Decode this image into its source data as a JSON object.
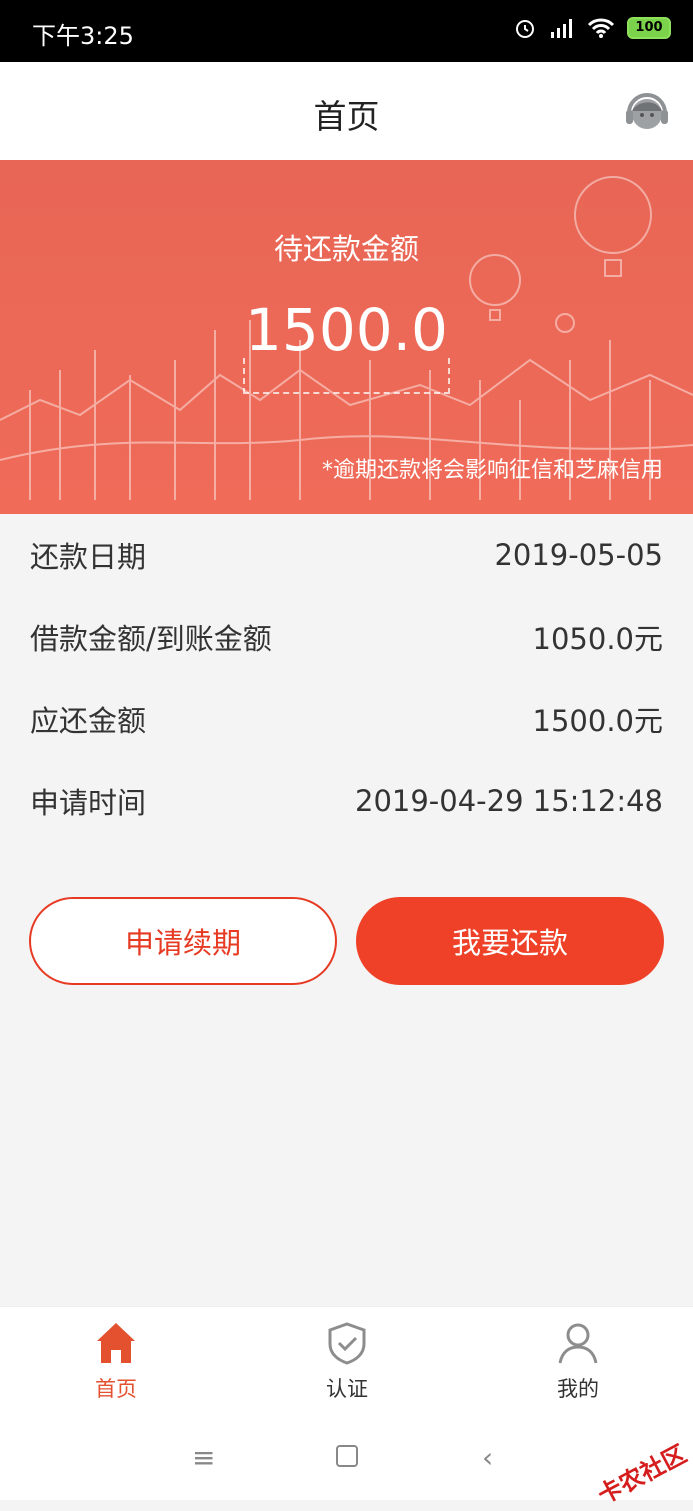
{
  "status_bar": {
    "time": "下午3:25",
    "battery": "100"
  },
  "nav": {
    "title": "首页"
  },
  "hero": {
    "label": "待还款金额",
    "amount": "1500.0",
    "note": "*逾期还款将会影响征信和芝麻信用"
  },
  "details": [
    {
      "label": "还款日期",
      "value": "2019-05-05"
    },
    {
      "label": "借款金额/到账金额",
      "value": "1050.0元"
    },
    {
      "label": "应还金额",
      "value": "1500.0元"
    },
    {
      "label": "申请时间",
      "value": "2019-04-29 15:12:48"
    }
  ],
  "buttons": {
    "renew": "申请续期",
    "repay": "我要还款"
  },
  "tabs": [
    {
      "label": "首页",
      "icon": "home-icon",
      "active": true
    },
    {
      "label": "认证",
      "icon": "shield-check-icon",
      "active": false
    },
    {
      "label": "我的",
      "icon": "user-icon",
      "active": false
    }
  ],
  "colors": {
    "accent": "#ee4128",
    "hero": "#f06b58",
    "active_tab": "#e4512e"
  },
  "watermark": "卡农社区"
}
